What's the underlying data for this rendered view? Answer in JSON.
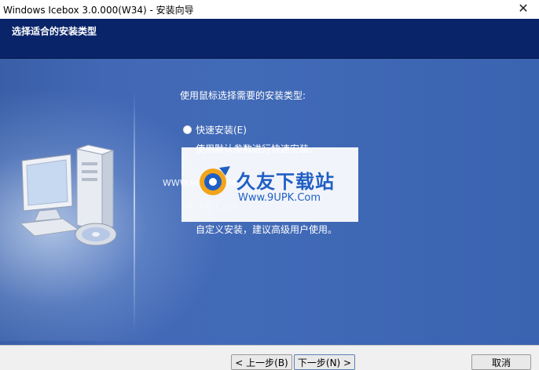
{
  "window": {
    "title": "Windows Icebox 3.0.000(W34) - 安装向导",
    "close_glyph": "✕"
  },
  "header": {
    "title": "选择适合的安装类型"
  },
  "main": {
    "instruction": "使用鼠标选择需要的安装类型:",
    "option_quick_label": "快速安装(E)",
    "option_quick_desc": "使用默认参数进行快速安装。",
    "option_custom_desc": "自定义安装，建议高级用户使用。"
  },
  "watermark": {
    "brand": "久友下载站",
    "url": "Www.9UPK.Com",
    "left_text": "WWW.9UPK.COM",
    "ghost_text": "9UPK.Com"
  },
  "footer": {
    "back_label": "< 上一步(B)",
    "next_label": "下一步(N) >",
    "cancel_label": "取消"
  },
  "colors": {
    "header_bg": "#0a246a",
    "body_bg": "#4268b5",
    "brand_blue": "#1f5fc4"
  }
}
